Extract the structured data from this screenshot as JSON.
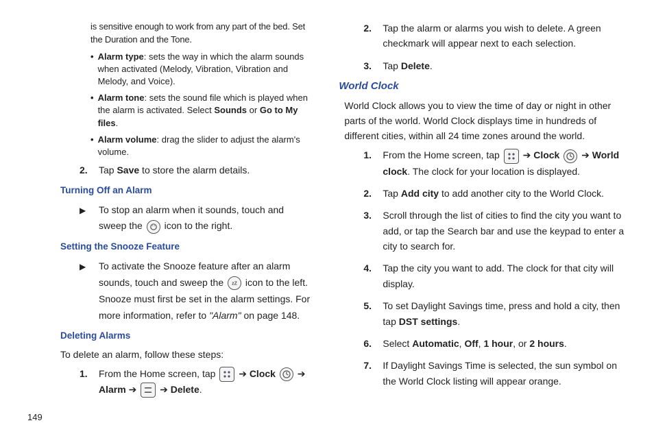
{
  "pageNumber": "149",
  "left": {
    "intro1": "is sensitive enough to work from any part of the bed. Set the Duration and the Tone.",
    "bullets": [
      {
        "term": "Alarm type",
        "desc": ": sets the way in which the alarm sounds when activated (Melody, Vibration, Vibration and Melody, and Voice)."
      },
      {
        "term": "Alarm tone",
        "pre": ": sets the sound file which is played when the alarm is activated. Select ",
        "b1": "Sounds",
        "mid": " or ",
        "b2": "Go to My files",
        "post": "."
      },
      {
        "term": "Alarm volume",
        "desc": ": drag the slider to adjust the alarm's volume."
      }
    ],
    "step2_pre": "Tap ",
    "step2_b": "Save",
    "step2_post": " to store the alarm details.",
    "head1": "Turning Off an Alarm",
    "off_pre": "To stop an alarm when it sounds, touch and sweep the ",
    "off_post": " icon to the right.",
    "head2": "Setting the Snooze Feature",
    "snooze_pre": "To activate the Snooze feature after an alarm sounds, touch and sweep the ",
    "snooze_mid": " icon to the left. Snooze must first be set in the alarm settings. For more information, refer to ",
    "snooze_ref": "\"Alarm\"",
    "snooze_post": "  on page 148.",
    "head3": "Deleting Alarms",
    "del_intro": "To delete an alarm, follow these steps:",
    "del_pre": "From the Home screen, tap ",
    "arrow": " ➔ ",
    "clock": "Clock",
    "alarm": "Alarm",
    "delete": "Delete",
    "dot": "."
  },
  "right": {
    "step2": "Tap the alarm or alarms you wish to delete. A green checkmark will appear next to each selection.",
    "step3_pre": "Tap ",
    "step3_b": "Delete",
    "step3_post": ".",
    "head": "World Clock",
    "intro": "World Clock allows you to view the time of day or night in other parts of the world. World Clock displays time in hundreds of different cities, within all 24 time zones around the world.",
    "s1_pre": "From the Home screen, tap ",
    "arrow": " ➔ ",
    "clock": "Clock",
    "worldclock": "World clock",
    "s1_post": ". The clock for your location is displayed.",
    "s2_pre": "Tap ",
    "s2_b": "Add city",
    "s2_post": " to add another city to the World Clock.",
    "s3": "Scroll through the list of cities to find the city you want to add, or tap the Search bar and use the keypad to enter a city to search for.",
    "s4": "Tap the city you want to add. The clock for that city will display.",
    "s5_pre": "To set Daylight Savings time, press and hold a city, then tap ",
    "s5_b": "DST settings",
    "s5_post": ".",
    "s6_pre": "Select ",
    "s6_b1": "Automatic",
    "s6_c1": ", ",
    "s6_b2": "Off",
    "s6_c2": ", ",
    "s6_b3": "1 hour",
    "s6_c3": ", or ",
    "s6_b4": "2 hours",
    "s6_post": ".",
    "s7": "If Daylight Savings Time is selected, the sun symbol on the World Clock listing will appear orange."
  }
}
